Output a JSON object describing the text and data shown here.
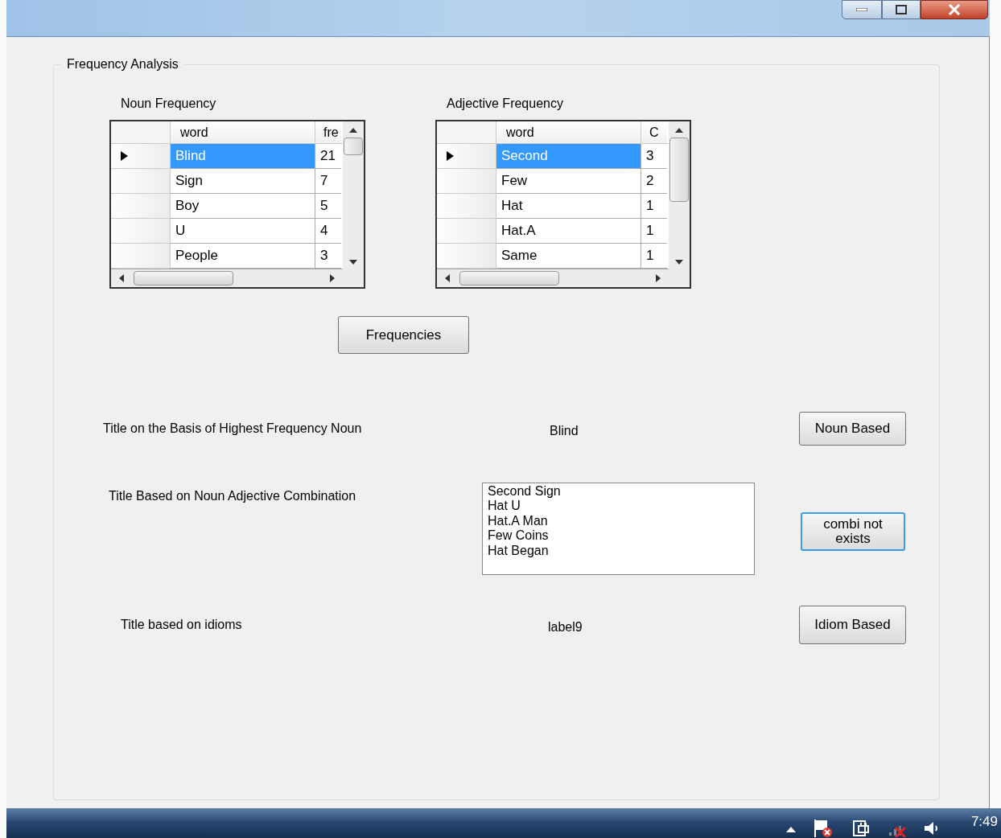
{
  "group": {
    "title": "Frequency Analysis"
  },
  "grids": [
    {
      "title": "Noun Frequency",
      "columns": [
        "word",
        "fre"
      ],
      "rows": [
        {
          "cells": [
            "Blind",
            "21"
          ],
          "selected": true
        },
        {
          "cells": [
            "Sign",
            "7"
          ],
          "selected": false
        },
        {
          "cells": [
            "Boy",
            "5"
          ],
          "selected": false
        },
        {
          "cells": [
            "U",
            "4"
          ],
          "selected": false
        },
        {
          "cells": [
            "People",
            "3"
          ],
          "selected": false
        }
      ]
    },
    {
      "title": "Adjective Frequency",
      "columns": [
        "word",
        "C"
      ],
      "rows": [
        {
          "cells": [
            "Second",
            "3"
          ],
          "selected": true
        },
        {
          "cells": [
            "Few",
            "2"
          ],
          "selected": false
        },
        {
          "cells": [
            "Hat",
            "1"
          ],
          "selected": false
        },
        {
          "cells": [
            "Hat.A",
            "1"
          ],
          "selected": false
        },
        {
          "cells": [
            "Same",
            "1"
          ],
          "selected": false
        }
      ]
    }
  ],
  "frequencies_button": "Frequencies",
  "results": [
    {
      "kind": "label",
      "caption": "Title on the Basis of Highest Frequency Noun",
      "value": "Blind",
      "button": {
        "label": "Noun Based",
        "focused": false
      }
    },
    {
      "kind": "list",
      "caption": "Title Based on Noun Adjective Combination",
      "items": [
        "Second Sign",
        "Hat U",
        "Hat.A Man",
        "Few Coins",
        "Hat Began"
      ],
      "button": {
        "label": "combi not exists",
        "focused": true
      }
    },
    {
      "kind": "label",
      "caption": "Title based on idioms",
      "value": "label9",
      "button": {
        "label": "Idiom Based",
        "focused": false
      }
    }
  ],
  "taskbar": {
    "time": "7:49"
  }
}
